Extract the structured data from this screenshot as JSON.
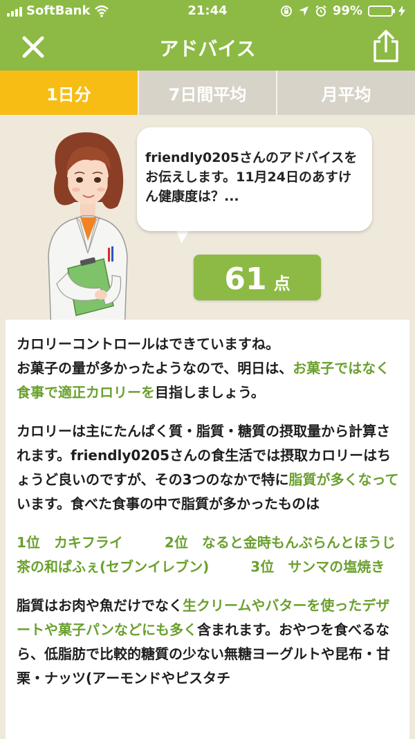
{
  "status_bar": {
    "carrier": "SoftBank",
    "time": "21:44",
    "battery_percent": "99%",
    "battery_level": 0.99
  },
  "nav": {
    "title": "アドバイス",
    "close_icon": "close-icon",
    "share_icon": "share-icon"
  },
  "tabs": [
    {
      "label": "1日分",
      "active": true
    },
    {
      "label": "7日間平均",
      "active": false
    },
    {
      "label": "月平均",
      "active": false
    }
  ],
  "bubble": {
    "text": "friendly0205さんのアドバイスをお伝えします。11月24日のあすけん健康度は？..."
  },
  "score": {
    "value": "61",
    "unit": "点"
  },
  "advice": {
    "p1": {
      "l1": "カロリーコントロールはできていますね。",
      "l2a": "お菓子の量が多かったようなので、明日は、",
      "l2h": "お菓子ではなく食事で適正カロリーを",
      "l2b": "目指しましょう。"
    },
    "p2": {
      "a": "カロリーは主にたんぱく質・脂質・糖質の摂取量から計算されます。friendly0205さんの食生活では摂取カロリーはちょうど良いのですが、その3つのなかで特に",
      "h": "脂質が多くなって",
      "b": "います。食べた食事の中で脂質が多かったものは"
    },
    "ranking": [
      "1位　カキフライ",
      "2位　なると金時もんぶらんとほうじ茶の和ぱふぇ(セブンイレブン)",
      "3位　サンマの塩焼き"
    ],
    "p4": {
      "a": "脂質はお肉や魚だけでなく",
      "h": "生クリームやバターを使ったデザートや菓子パンなどにも多く",
      "b": "含まれます。おやつを食べるなら、低脂肪で比較的糖質の少ない無糖ヨーグルトや昆布・甘栗・ナッツ(アーモンドやピスタチ"
    }
  },
  "colors": {
    "header_green": "#8cba44",
    "tab_active": "#f8bd14",
    "tab_inactive": "#d8d3c9",
    "highlight_text": "#6aa02e",
    "background": "#efe9dc"
  }
}
